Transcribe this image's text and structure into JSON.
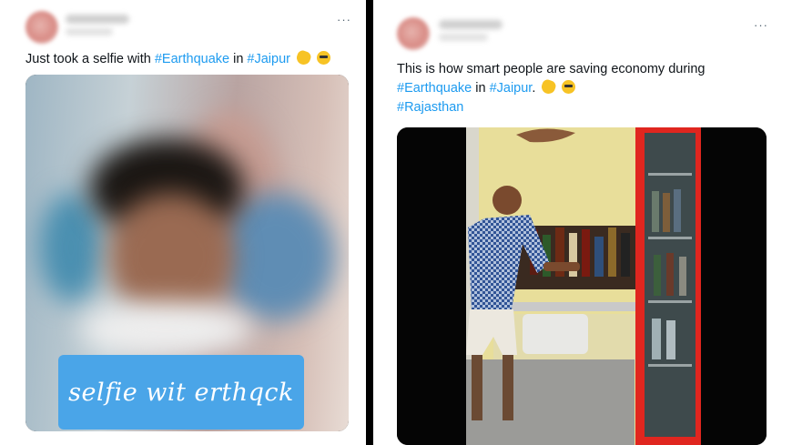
{
  "left_tweet": {
    "text": {
      "prefix": "Just took a selfie with ",
      "hashtag_1": "#Earthquake",
      "middle": " in ",
      "hashtag_2": "#Jaipur"
    },
    "more_label": "···",
    "emojis": [
      "pointing-down-hand-emoji",
      "face-with-monocle-emoji"
    ],
    "media_caption": "selfie wit erthqck"
  },
  "right_tweet": {
    "text": {
      "line_1": "This is how smart people are saving economy during",
      "hashtag_1": "#Earthquake",
      "middle": " in ",
      "hashtag_2": "#Jaipur",
      "period": ".",
      "hashtag_3": "#Rajasthan"
    },
    "more_label": "···",
    "emojis": [
      "pointing-down-hand-emoji",
      "smiling-face-with-sunglasses-emoji"
    ]
  },
  "colors": {
    "hashtag": "#1d9bf0",
    "text": "#0f1419",
    "divider": "#000000",
    "caption_bg": "#4aa5e8",
    "fridge_red": "#e0261f"
  }
}
